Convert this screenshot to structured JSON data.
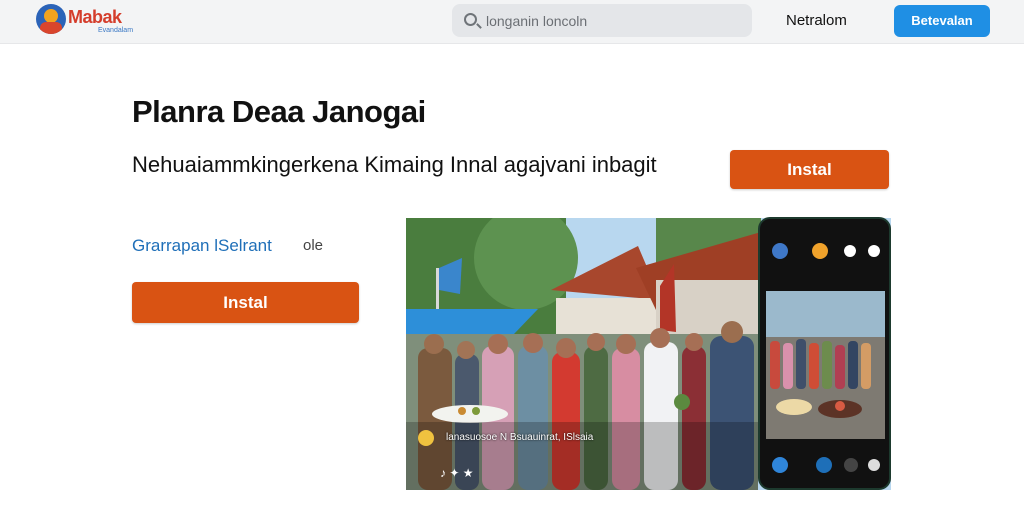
{
  "header": {
    "brand": "Mabak",
    "brand_sub": "Evandalam",
    "search_placeholder": "longanin loncoln",
    "nav_link": "Netralom",
    "top_button": "Betevalan"
  },
  "app": {
    "title": "Planra Deaa Janogai",
    "subtitle": "Nehuaiammkingerkena Kimaing Innal agajvani inbagit",
    "developer": "Grarrapan lSelrant",
    "developer_extra": "ole",
    "install_label": "Instal",
    "install_label_right": "Instal"
  },
  "media": {
    "caption": "lanasuosoe N Bsuauinrat, ISlsaia",
    "icons_text": "♪ ✦ ★",
    "colors": {
      "sky": "#b8d7ef",
      "roof": "#a8472d",
      "tree": "#4a7d3e",
      "umbrella": "#2d8fd9",
      "flag": "#3a86cc"
    }
  },
  "colors": {
    "accent_orange": "#d95313",
    "accent_blue": "#1f8fe4",
    "link_blue": "#1f6fb8"
  }
}
